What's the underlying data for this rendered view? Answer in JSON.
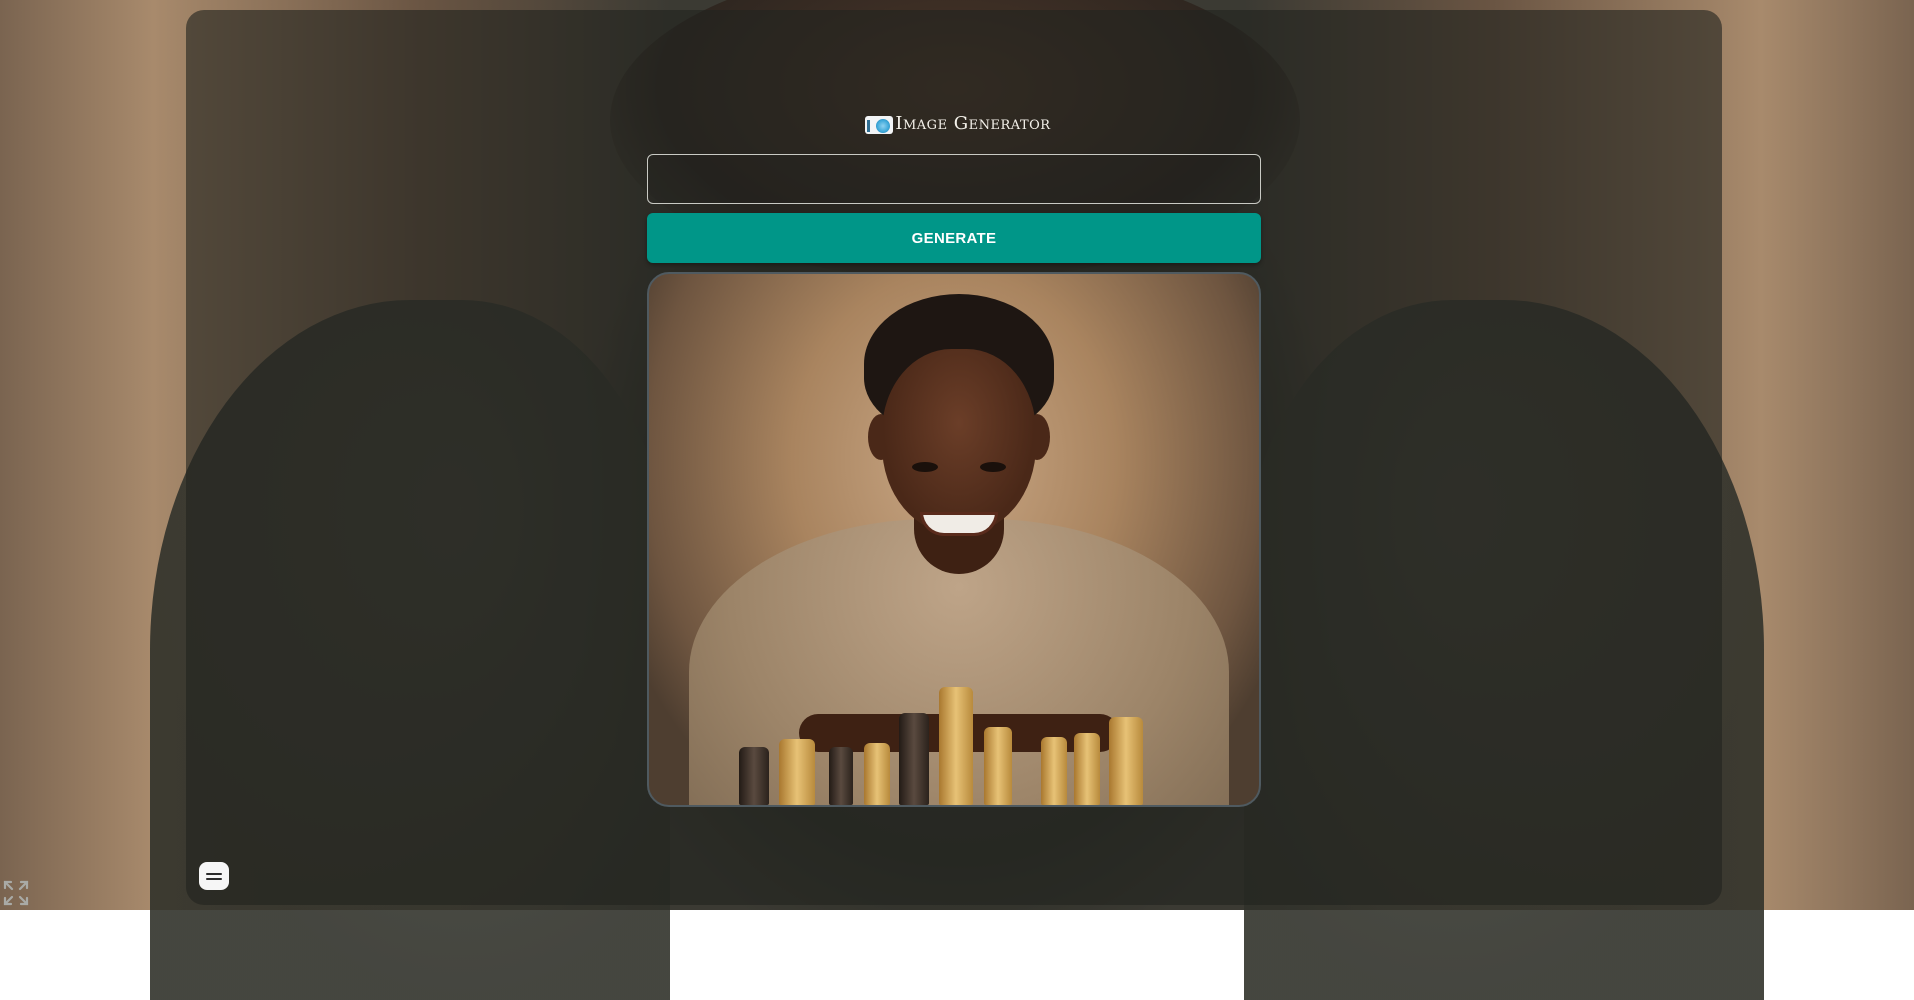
{
  "header": {
    "logo_icon": "camera-icon",
    "title": "Image Generator"
  },
  "prompt": {
    "value": "",
    "placeholder": ""
  },
  "generate_button": {
    "label": "GENERATE",
    "color": "#009688"
  },
  "result": {
    "image_subject": "generated-image"
  },
  "chat_widget": {
    "icon": "chat-bubble-icon"
  },
  "fullscreen": {
    "icon": "expand-icon"
  }
}
